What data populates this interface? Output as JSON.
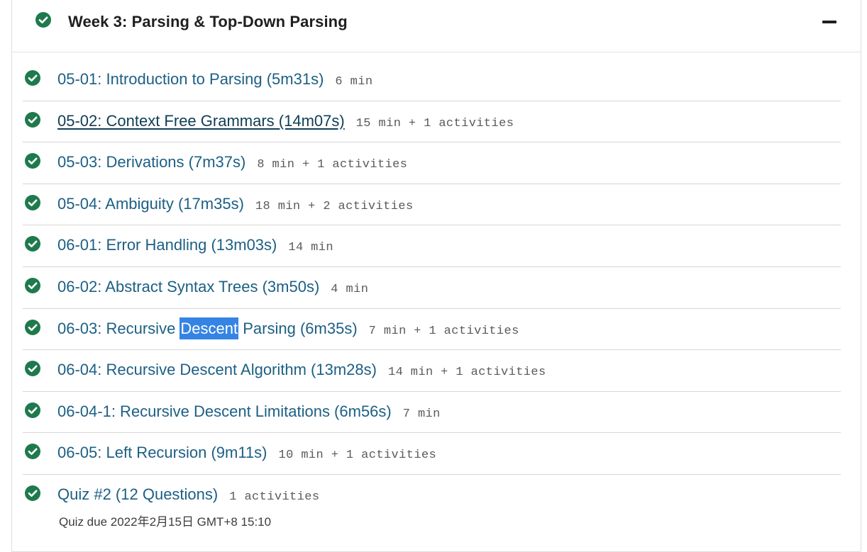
{
  "week": {
    "title": "Week 3: Parsing & Top-Down Parsing",
    "header_icon": "check-circle-icon",
    "collapse_icon": "minus-icon"
  },
  "colors": {
    "check_green": "#1e7a4c",
    "link": "#1c5f84",
    "meta": "#5a5a5a",
    "selection": "#3584e4"
  },
  "lessons": [
    {
      "title": "05-01: Introduction to Parsing (5m31s)",
      "meta": "6 min",
      "completed": true
    },
    {
      "title": "05-02: Context Free Grammars (14m07s)",
      "meta": "15 min + 1 activities",
      "completed": true
    },
    {
      "title": "05-03: Derivations (7m37s)",
      "meta": "8 min + 1 activities",
      "completed": true
    },
    {
      "title": "05-04: Ambiguity (17m35s)",
      "meta": "18 min + 2 activities",
      "completed": true
    },
    {
      "title": "06-01: Error Handling (13m03s)",
      "meta": "14 min",
      "completed": true
    },
    {
      "title": "06-02: Abstract Syntax Trees (3m50s)",
      "meta": "4 min",
      "completed": true
    },
    {
      "title_parts": [
        "06-03: Recursive ",
        "Descent",
        " Parsing (6m35s)"
      ],
      "meta": "7 min + 1 activities",
      "completed": true
    },
    {
      "title": "06-04: Recursive Descent Algorithm (13m28s)",
      "meta": "14 min + 1 activities",
      "completed": true
    },
    {
      "title": "06-04-1: Recursive Descent Limitations (6m56s)",
      "meta": "7 min",
      "completed": true
    },
    {
      "title": "06-05: Left Recursion (9m11s)",
      "meta": "10 min + 1 activities",
      "completed": true
    },
    {
      "title": "Quiz #2 (12 Questions)",
      "meta": "1 activities",
      "due": "Quiz due 2022年2月15日 GMT+8 15:10",
      "completed": true
    }
  ]
}
